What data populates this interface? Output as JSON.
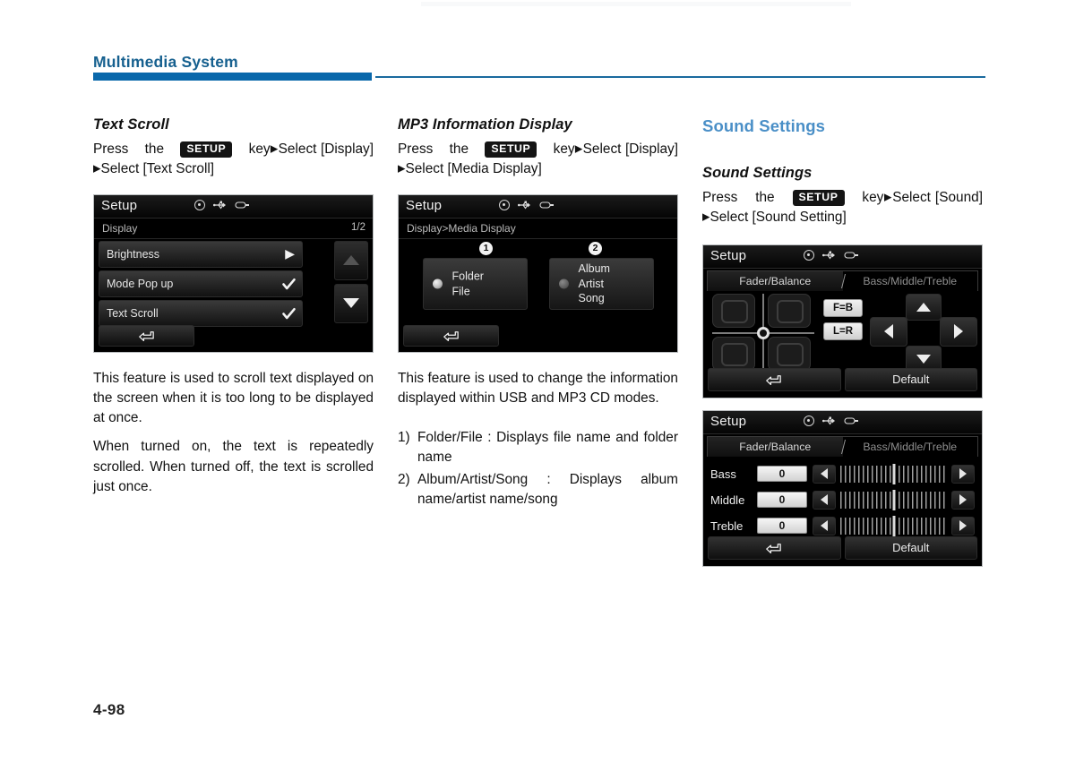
{
  "document": {
    "running_header": "Multimedia System",
    "folio": "4-98",
    "accent_header": "#16608f",
    "accent_rule": "#0a68ab",
    "accent_section": "#4a8fc7"
  },
  "columns": {
    "left": {
      "sub_head": "Text Scroll",
      "instruction": {
        "press": "Press",
        "the": "the",
        "key_badge": "SETUP",
        "key": "key",
        "arrow": "▶",
        "select1": "Select [Display]",
        "arrow2": "▶",
        "select2": "Select [Text Scroll]"
      },
      "paragraphs": [
        "This feature is used to scroll text displayed on the screen when it is too long to be displayed at once.",
        "When turned on, the text is repeatedly scrolled. When turned off, the text is scrolled just once."
      ]
    },
    "middle": {
      "sub_head": "MP3 Information Display",
      "instruction": {
        "press": "Press",
        "the": "the",
        "key_badge": "SETUP",
        "key": "key",
        "arrow": "▶",
        "select1": "Select [Display]",
        "arrow2": "▶",
        "select2": "Select [Media Display]"
      },
      "paragraphs": [
        "This feature is used to change the information displayed within USB and MP3 CD modes."
      ],
      "numbered": [
        {
          "num": "1)",
          "text": "Folder/File : Displays file name and folder name"
        },
        {
          "num": "2)",
          "text": "Album/Artist/Song : Displays album name/artist name/song"
        }
      ]
    },
    "right": {
      "section_head": "Sound Settings",
      "sub_head": "Sound Settings",
      "instruction": {
        "press": "Press",
        "the": "the",
        "key_badge": "SETUP",
        "key": "key",
        "arrow": "▶",
        "select1": "Select [Sound]",
        "arrow2": "▶",
        "select2": "Select [Sound Setting]"
      }
    }
  },
  "screens": {
    "display_list": {
      "title": "Setup",
      "icons": [
        "disc-icon",
        "usb-icon",
        "aux-device-icon"
      ],
      "breadcrumb": "Display",
      "page_indicator": "1/2",
      "rows": [
        {
          "label": "Brightness",
          "mark": "▶",
          "type": "arrow"
        },
        {
          "label": "Mode Pop up",
          "mark": "✓",
          "type": "check"
        },
        {
          "label": "Text Scroll",
          "mark": "✓",
          "type": "check"
        }
      ],
      "scroll_up": "scroll-up",
      "scroll_down": "scroll-down",
      "back": "back"
    },
    "media_display": {
      "title": "Setup",
      "breadcrumb": "Display>Media Display",
      "callouts": [
        "①",
        "②"
      ],
      "options": [
        {
          "number": "1",
          "lines": [
            "Folder",
            "File"
          ],
          "selected": true
        },
        {
          "number": "2",
          "lines": [
            "Album",
            "Artist",
            "Song"
          ],
          "selected": false
        }
      ],
      "back": "back"
    },
    "fader_balance": {
      "title": "Setup",
      "tabs": [
        {
          "label": "Fader/Balance",
          "active": true
        },
        {
          "label": "Bass/Middle/Treble",
          "active": false
        }
      ],
      "eq_buttons": [
        "F=B",
        "L=R"
      ],
      "dpad": [
        "up",
        "left",
        "right",
        "down"
      ],
      "back": "back",
      "default_label": "Default"
    },
    "bass_middle_treble": {
      "title": "Setup",
      "tabs": [
        {
          "label": "Fader/Balance",
          "active": false
        },
        {
          "label": "Bass/Middle/Treble",
          "active": true
        }
      ],
      "rows": [
        {
          "label": "Bass",
          "value": "0"
        },
        {
          "label": "Middle",
          "value": "0"
        },
        {
          "label": "Treble",
          "value": "0"
        }
      ],
      "back": "back",
      "default_label": "Default"
    }
  }
}
